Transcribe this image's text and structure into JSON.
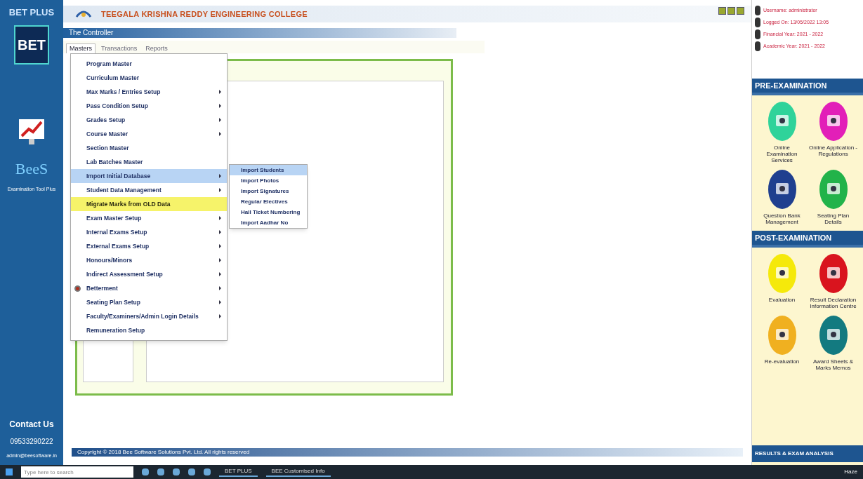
{
  "sidebar": {
    "brand": "BET PLUS",
    "badge": "BET",
    "product": "BeeS",
    "tagline": "Examination Tool Plus",
    "contact_title": "Contact Us",
    "phone": "09533290222",
    "email": "admin@beesoftware.in"
  },
  "header": {
    "college": "TEEGALA KRISHNA REDDY ENGINEERING COLLEGE"
  },
  "title_bar": "The Controller",
  "tabs": [
    {
      "label": "Masters",
      "selected": true
    },
    {
      "label": "Transactions",
      "selected": false
    },
    {
      "label": "Reports",
      "selected": false
    }
  ],
  "menu": [
    {
      "label": "Program Master",
      "selected": false,
      "flagged": false,
      "has_submenu": false,
      "has_icon": false
    },
    {
      "label": "Curriculum Master",
      "selected": false,
      "flagged": false,
      "has_submenu": false,
      "has_icon": false
    },
    {
      "label": "Max Marks / Entries Setup",
      "selected": false,
      "flagged": false,
      "has_submenu": true,
      "has_icon": false
    },
    {
      "label": "Pass Condition Setup",
      "selected": false,
      "flagged": false,
      "has_submenu": true,
      "has_icon": false
    },
    {
      "label": "Grades Setup",
      "selected": false,
      "flagged": false,
      "has_submenu": true,
      "has_icon": false
    },
    {
      "label": "Course Master",
      "selected": false,
      "flagged": false,
      "has_submenu": true,
      "has_icon": false
    },
    {
      "label": "Section Master",
      "selected": false,
      "flagged": false,
      "has_submenu": false,
      "has_icon": false
    },
    {
      "label": "Lab Batches Master",
      "selected": false,
      "flagged": false,
      "has_submenu": false,
      "has_icon": false
    },
    {
      "label": "Import Initial Database",
      "selected": true,
      "flagged": false,
      "has_submenu": true,
      "has_icon": false
    },
    {
      "label": "Student Data Management",
      "selected": false,
      "flagged": false,
      "has_submenu": true,
      "has_icon": false
    },
    {
      "label": "Migrate Marks from OLD Data",
      "selected": false,
      "flagged": true,
      "has_submenu": false,
      "has_icon": false
    },
    {
      "label": "Exam Master Setup",
      "selected": false,
      "flagged": false,
      "has_submenu": true,
      "has_icon": false
    },
    {
      "label": "Internal Exams Setup",
      "selected": false,
      "flagged": false,
      "has_submenu": true,
      "has_icon": false
    },
    {
      "label": "External Exams Setup",
      "selected": false,
      "flagged": false,
      "has_submenu": true,
      "has_icon": false
    },
    {
      "label": "Honours/Minors",
      "selected": false,
      "flagged": false,
      "has_submenu": true,
      "has_icon": false
    },
    {
      "label": "Indirect Assessment Setup",
      "selected": false,
      "flagged": false,
      "has_submenu": true,
      "has_icon": false
    },
    {
      "label": "Betterment",
      "selected": false,
      "flagged": false,
      "has_submenu": true,
      "has_icon": true
    },
    {
      "label": "Seating Plan Setup",
      "selected": false,
      "flagged": false,
      "has_submenu": true,
      "has_icon": false
    },
    {
      "label": "Faculty/Examiners/Admin Login Details",
      "selected": false,
      "flagged": false,
      "has_submenu": true,
      "has_icon": false
    },
    {
      "label": "Remuneration Setup",
      "selected": false,
      "flagged": false,
      "has_submenu": false,
      "has_icon": false
    }
  ],
  "submenu": [
    {
      "label": "Import Students",
      "selected": true
    },
    {
      "label": "Import Photos",
      "selected": false
    },
    {
      "label": "Import Signatures",
      "selected": false
    },
    {
      "label": "Regular Electives",
      "selected": false
    },
    {
      "label": "Hall Ticket Numbering",
      "selected": false
    },
    {
      "label": "Import Aadhar No",
      "selected": false
    }
  ],
  "user_info": [
    "Username: administrator",
    "Logged On: 13/05/2022 13:05",
    "Financial Year: 2021 - 2022",
    "Academic Year: 2021 - 2022"
  ],
  "pre_exam": {
    "title": "PRE-EXAMINATION",
    "tiles": [
      {
        "label": "Online Examination Services",
        "color": "#2fd39a"
      },
      {
        "label": "Online Application - Regulations",
        "color": "#e21fb8"
      },
      {
        "label": "Question Bank Management",
        "color": "#1f3f8f"
      },
      {
        "label": "Seating Plan Details",
        "color": "#22b34a"
      }
    ]
  },
  "post_exam": {
    "title": "POST-EXAMINATION",
    "tiles": [
      {
        "label": "Evaluation",
        "color": "#f5e90a"
      },
      {
        "label": "Result Declaration Information Centre",
        "color": "#d9141e"
      },
      {
        "label": "Re-evaluation",
        "color": "#f0b020"
      },
      {
        "label": "Award Sheets & Marks Memos",
        "color": "#137a80"
      }
    ]
  },
  "results_bar": "RESULTS & EXAM ANALYSIS",
  "footer": "Copyright © 2018 Bee Software Solutions Pvt. Ltd. All rights reserved",
  "taskbar": {
    "search_placeholder": "Type here to search",
    "apps": [
      "BET PLUS",
      "BEE Customised Info"
    ],
    "weather": "Haze"
  }
}
